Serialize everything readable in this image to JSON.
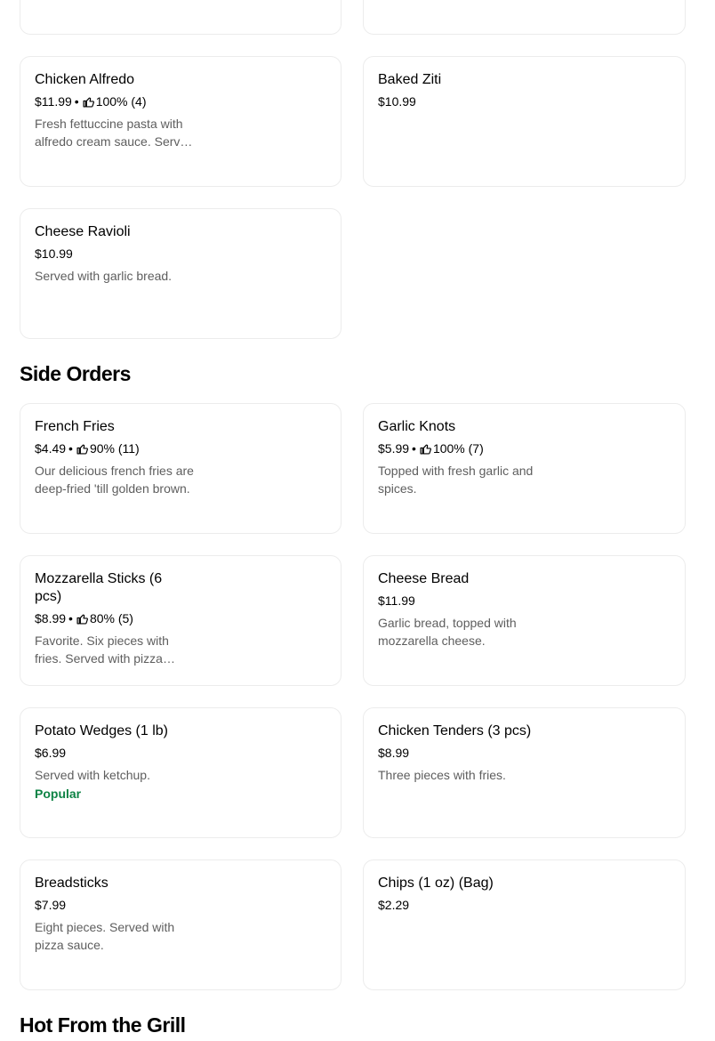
{
  "sections": [
    {
      "title": "Side Orders"
    },
    {
      "title": "Hot From the Grill"
    }
  ],
  "items": [
    {
      "name": "Chicken Alfredo",
      "price": "$11.99",
      "sep": "•",
      "rating": "100% (4)",
      "desc": "Fresh fettuccine pasta with alfredo cream sauce. Served with garlic bread."
    },
    {
      "name": "Baked Ziti",
      "price": "$10.99"
    },
    {
      "name": "Cheese Ravioli",
      "price": "$10.99",
      "desc": "Served with garlic bread."
    },
    {
      "name": "French Fries",
      "price": "$4.49",
      "sep": "•",
      "rating": "90% (11)",
      "desc": "Our delicious french fries are deep-fried 'till golden brown."
    },
    {
      "name": "Garlic Knots",
      "price": "$5.99",
      "sep": "•",
      "rating": "100% (7)",
      "desc": "Topped with fresh garlic and spices."
    },
    {
      "name": "Mozzarella Sticks (6 pcs)",
      "price": "$8.99",
      "sep": "•",
      "rating": "80% (5)",
      "desc": "Favorite. Six pieces with fries. Served with pizza sauce."
    },
    {
      "name": "Cheese Bread",
      "price": "$11.99",
      "desc": "Garlic bread, topped with mozzarella cheese."
    },
    {
      "name": "Potato Wedges (1 lb)",
      "price": "$6.99",
      "desc": "Served with ketchup.",
      "badge": "Popular"
    },
    {
      "name": "Chicken Tenders (3 pcs)",
      "price": "$8.99",
      "desc": "Three pieces with fries."
    },
    {
      "name": "Breadsticks",
      "price": "$7.99",
      "desc": "Eight pieces. Served with pizza sauce."
    },
    {
      "name": "Chips (1 oz) (Bag)",
      "price": "$2.29"
    }
  ],
  "icons": {
    "rating": "thumbs-up-icon"
  },
  "colors": {
    "popular": "#0e8345",
    "description": "#5e5e5e"
  }
}
